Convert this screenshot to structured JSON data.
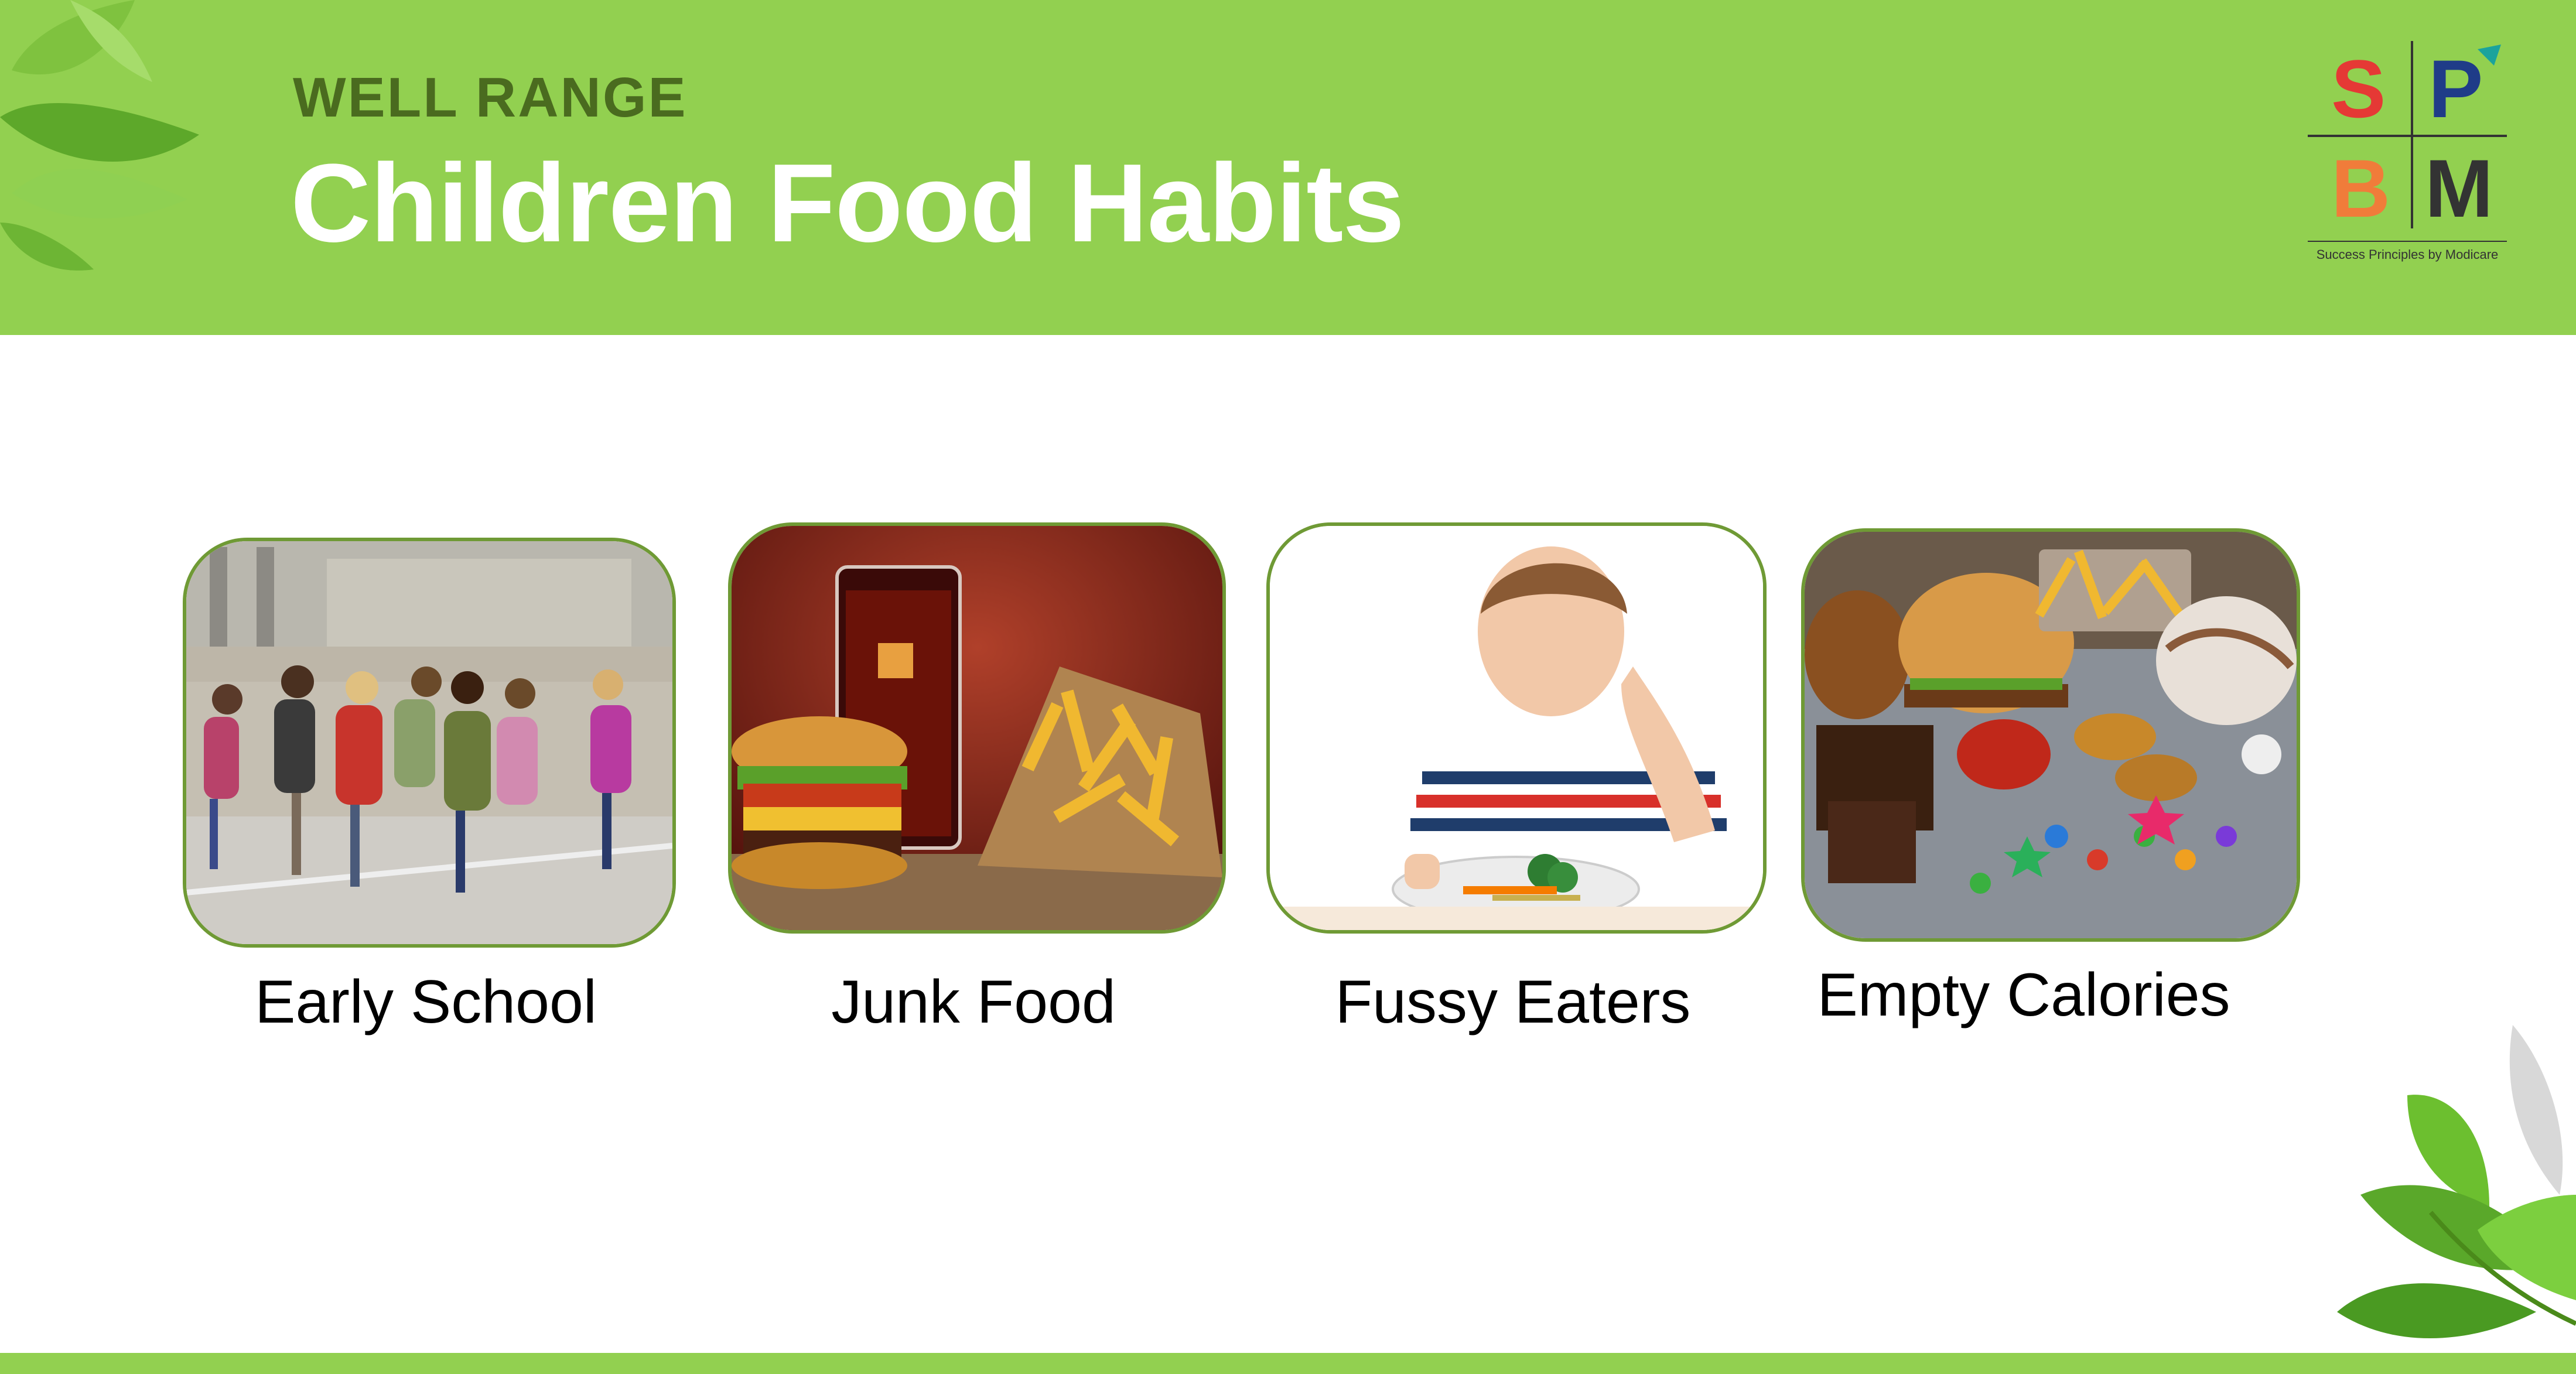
{
  "header": {
    "subtitle": "WELL RANGE",
    "title": "Children Food Habits"
  },
  "logo": {
    "letters": [
      "S",
      "P",
      "B",
      "M"
    ],
    "caption": "Success Principles by Modicare"
  },
  "cards": [
    {
      "label": "Early School"
    },
    {
      "label": "Junk Food"
    },
    {
      "label": "Fussy Eaters"
    },
    {
      "label": "Empty Calories"
    }
  ],
  "colors": {
    "header_green": "#92d050",
    "card_border": "#6f9a35",
    "logo_s": "#e53935",
    "logo_p": "#1f3c88",
    "logo_b": "#f07c3a",
    "logo_m": "#333333"
  },
  "decorations": [
    "leaf-cluster-top-left",
    "leaf-cluster-bottom-right"
  ]
}
